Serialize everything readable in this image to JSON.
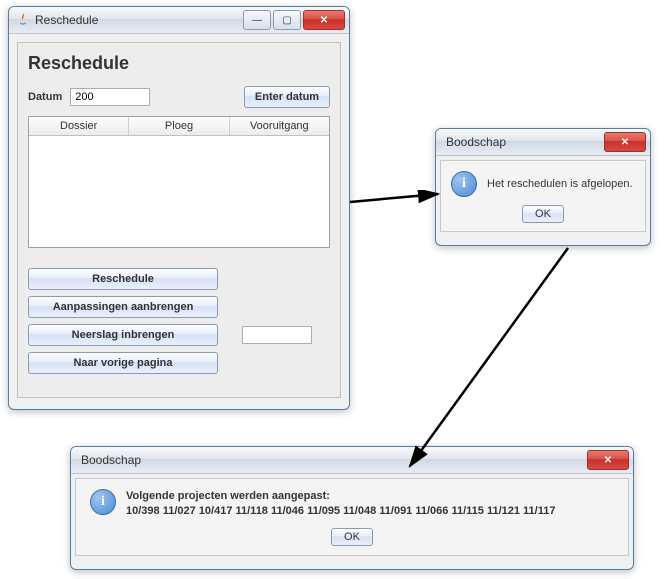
{
  "main": {
    "title": "Reschedule",
    "heading": "Reschedule",
    "datum_label": "Datum",
    "datum_value": "200",
    "enter_datum": "Enter datum",
    "table": {
      "col1": "Dossier",
      "col2": "Ploeg",
      "col3": "Vooruitgang"
    },
    "buttons": {
      "reschedule": "Reschedule",
      "aanpassingen": "Aanpassingen aanbrengen",
      "neerslag": "Neerslag inbrengen",
      "vorige": "Naar vorige pagina"
    },
    "neerslag_value": ""
  },
  "msg1": {
    "title": "Boodschap",
    "text": "Het reschedulen is afgelopen.",
    "ok": "OK"
  },
  "msg2": {
    "title": "Boodschap",
    "line1": "Volgende projecten werden aangepast:",
    "line2": "10/398 11/027 10/417 11/118 11/046 11/095 11/048 11/091 11/066 11/115 11/121 11/117",
    "ok": "OK"
  },
  "icons": {
    "min": "—",
    "max": "▢",
    "close": "✕",
    "info": "i"
  }
}
